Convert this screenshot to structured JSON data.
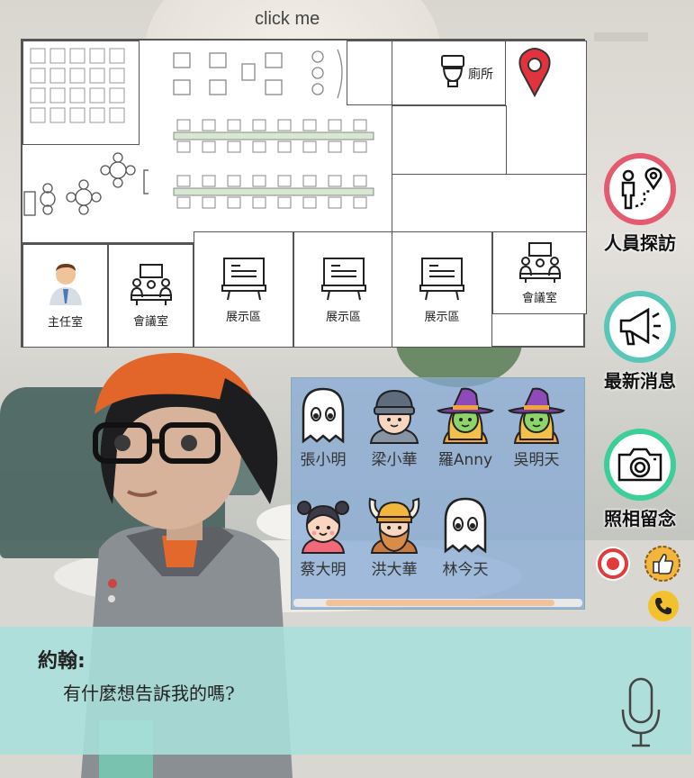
{
  "header": {
    "click_me": "click me"
  },
  "floorplan": {
    "toilet_label": "廁所",
    "rooms": [
      {
        "label": "主任室",
        "icon": "manager-person-icon"
      },
      {
        "label": "會議室",
        "icon": "meeting-room-icon"
      },
      {
        "label": "展示區",
        "icon": "presentation-board-icon"
      },
      {
        "label": "展示區",
        "icon": "presentation-board-icon"
      },
      {
        "label": "展示區",
        "icon": "presentation-board-icon"
      },
      {
        "label": "會議室",
        "icon": "meeting-room-icon"
      }
    ],
    "location_pin": "map-pin-icon"
  },
  "side_buttons": [
    {
      "label": "人員探訪",
      "icon": "person-visit-icon",
      "color": "#e45a6f"
    },
    {
      "label": "最新消息",
      "icon": "megaphone-icon",
      "color": "#58c7b8"
    },
    {
      "label": "照相留念",
      "icon": "camera-icon",
      "color": "#3ccf9a"
    }
  ],
  "people": [
    {
      "name": "張小明",
      "icon": "ghost-icon"
    },
    {
      "name": "梁小華",
      "icon": "beanie-boy-icon"
    },
    {
      "name": "羅Anny",
      "icon": "witch-icon"
    },
    {
      "name": "吳明天",
      "icon": "witch-icon"
    },
    {
      "name": "蔡大明",
      "icon": "girl-buns-icon"
    },
    {
      "name": "洪大華",
      "icon": "viking-icon"
    },
    {
      "name": "林今天",
      "icon": "ghost-icon"
    }
  ],
  "small_buttons": {
    "record": "record-icon",
    "like": "thumbs-up-icon",
    "phone": "phone-icon"
  },
  "dialog": {
    "speaker": "約翰:",
    "message": "有什麼想告訴我的嗎?"
  },
  "colors": {
    "dialog_bg": "#a8e0db",
    "panel_bg": "#85aad6",
    "pin": "#e0333d"
  }
}
